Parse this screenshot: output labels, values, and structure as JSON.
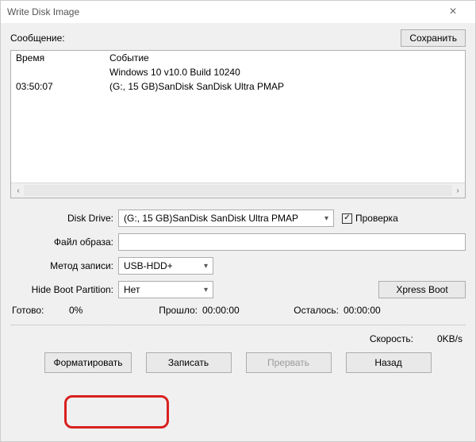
{
  "window": {
    "title": "Write Disk Image"
  },
  "top": {
    "message_label": "Сообщение:",
    "save_btn": "Сохранить"
  },
  "log": {
    "col_time": "Время",
    "col_event": "Событие",
    "rows": [
      {
        "time": "",
        "event": "Windows 10 v10.0 Build 10240"
      },
      {
        "time": "03:50:07",
        "event": "(G:, 15 GB)SanDisk SanDisk Ultra   PMAP"
      }
    ]
  },
  "form": {
    "disk_drive_label": "Disk Drive:",
    "disk_drive_value": "(G:, 15 GB)SanDisk SanDisk Ultra  PMAP",
    "verify_label": "Проверка",
    "image_file_label": "Файл образа:",
    "write_method_label": "Метод записи:",
    "write_method_value": "USB-HDD+",
    "hide_boot_label": "Hide Boot Partition:",
    "hide_boot_value": "Нет",
    "xpress_boot_btn": "Xpress Boot"
  },
  "status": {
    "ready_label": "Готово:",
    "ready_value": "0%",
    "elapsed_label": "Прошло:",
    "elapsed_value": "00:00:00",
    "remain_label": "Осталось:",
    "remain_value": "00:00:00"
  },
  "footer": {
    "speed_label": "Скорость:",
    "speed_value": "0KB/s",
    "format_btn": "Форматировать",
    "write_btn": "Записать",
    "abort_btn": "Прервать",
    "back_btn": "Назад"
  }
}
